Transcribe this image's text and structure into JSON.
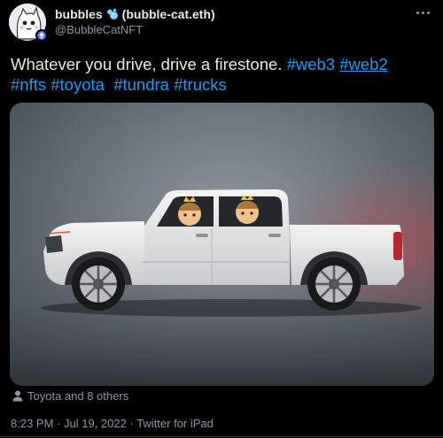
{
  "author": {
    "display_name": "bubbles",
    "ens_name": "(bubble-cat.eth)",
    "handle": "@BubbleCatNFT",
    "avatar_icon": "cat-avatar-icon",
    "badge_icon": "ethereum-icon",
    "name_emoji": "bubbles-emoji-icon"
  },
  "tweet": {
    "text_plain": "Whatever you drive, drive a firestone.",
    "hashtags": [
      "#web3",
      "#web2",
      "#nfts",
      "#toyota",
      "#tundra",
      "#trucks"
    ],
    "link_color": "#1d9bf0"
  },
  "media": {
    "tagged_label": "Toyota and 8 others",
    "tagged_icon": "person-icon",
    "image_subject": "pickup-truck-photo"
  },
  "meta": {
    "time": "8:23 PM",
    "date": "Jul 19, 2022",
    "source": "Twitter for iPad"
  },
  "colors": {
    "background": "#000000",
    "primary_text": "#e7e9ea",
    "secondary_text": "#8b98a5",
    "accent": "#1d9bf0"
  }
}
